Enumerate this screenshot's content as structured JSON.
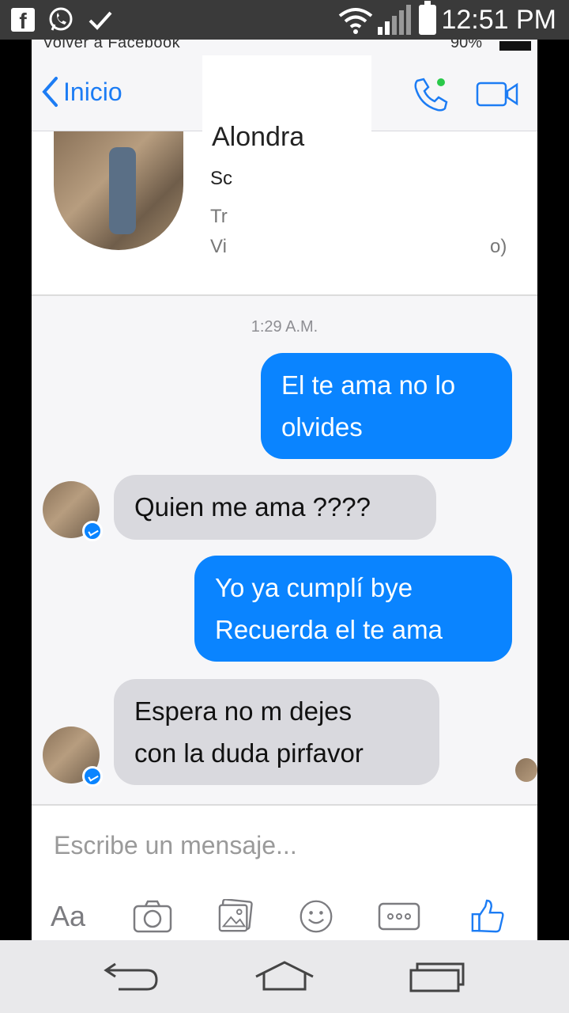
{
  "android_status": {
    "time": "12:51 PM"
  },
  "ios_status": {
    "back_to_app": "Volver a Facebook",
    "battery": "90%"
  },
  "nav": {
    "back_label": "Inicio"
  },
  "profile": {
    "name": "Alondra",
    "line1": "Sc",
    "line2": "Tr",
    "line3": "Vi",
    "line3_tail": "o)"
  },
  "chat": {
    "timestamp": "1:29 A.M.",
    "messages": [
      {
        "direction": "out",
        "lines": [
          "El te ama no lo",
          "olvides"
        ]
      },
      {
        "direction": "in",
        "lines": [
          "Quien me ama ????"
        ]
      },
      {
        "direction": "out",
        "lines": [
          "Yo ya cumplí bye",
          "Recuerda el te ama"
        ]
      },
      {
        "direction": "in",
        "lines": [
          "Espera no m dejes",
          "con la duda pirfavor"
        ]
      }
    ]
  },
  "composer": {
    "placeholder": "Escribe un mensaje...",
    "aa_label": "Aa"
  },
  "colors": {
    "accent": "#0a84ff",
    "incoming": "#d9d9de",
    "link": "#1c7cf4"
  }
}
